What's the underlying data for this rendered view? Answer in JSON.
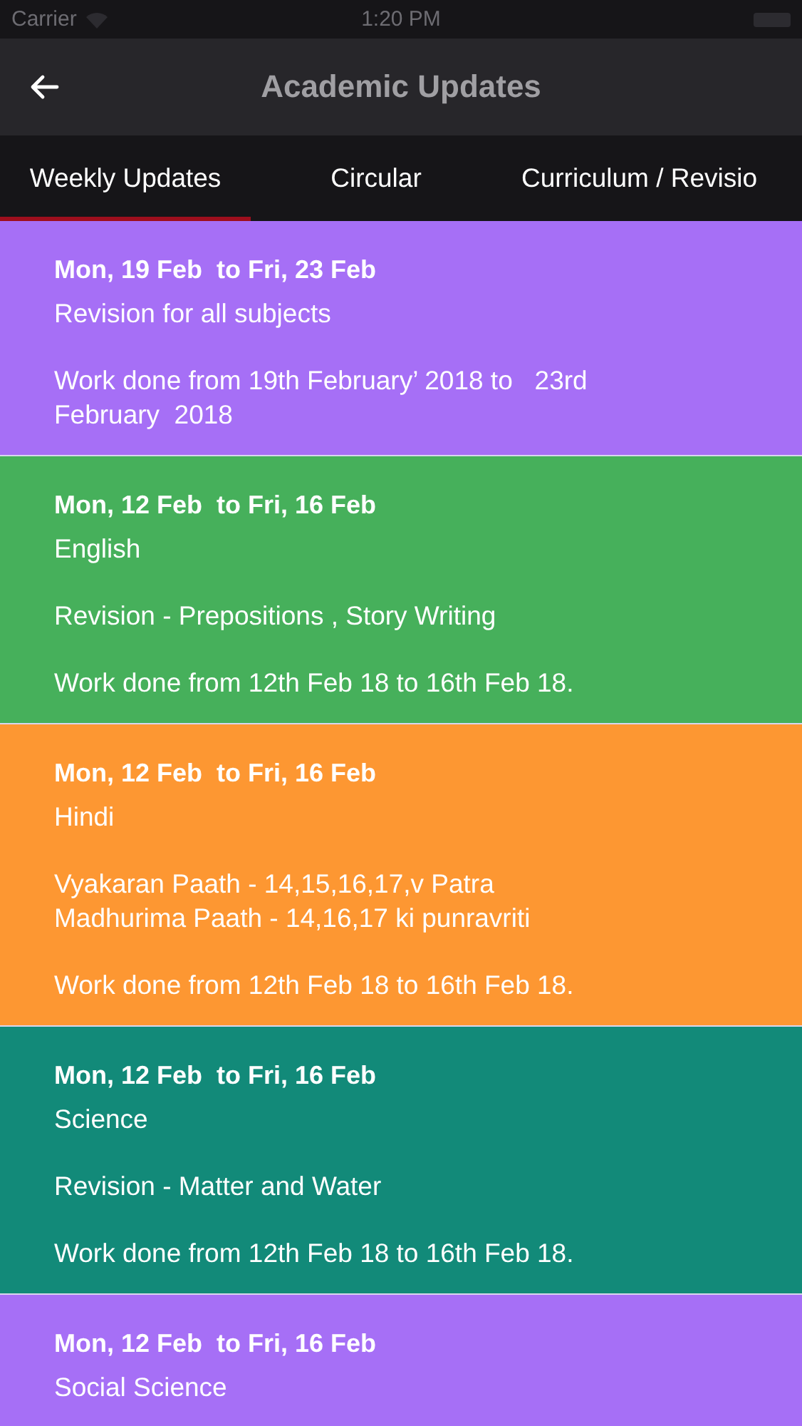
{
  "status_bar": {
    "carrier": "Carrier",
    "time": "1:20 PM"
  },
  "nav": {
    "title": "Academic Updates"
  },
  "tabs": [
    {
      "label": "Weekly Updates",
      "selected": true
    },
    {
      "label": "Circular",
      "selected": false
    },
    {
      "label": "Curriculum / Revisio",
      "selected": false
    }
  ],
  "updates": [
    {
      "color": "#a66ff6",
      "dates": "Mon, 19 Feb  to Fri, 23 Feb",
      "subject": "Revision for all subjects",
      "paragraphs": [
        [
          "Work done from 19th February’ 2018 to   23rd",
          "February  2018"
        ]
      ]
    },
    {
      "color": "#46b05b",
      "dates": "Mon, 12 Feb  to Fri, 16 Feb",
      "subject": "English",
      "paragraphs": [
        [
          "Revision - Prepositions , Story Writing"
        ],
        [
          "Work done from 12th Feb 18 to 16th Feb 18."
        ]
      ]
    },
    {
      "color": "#fd9732",
      "dates": "Mon, 12 Feb  to Fri, 16 Feb",
      "subject": "Hindi",
      "paragraphs": [
        [
          "Vyakaran Paath - 14,15,16,17,v Patra",
          "Madhurima Paath - 14,16,17 ki punravriti"
        ],
        [
          "Work done from 12th Feb 18 to 16th Feb 18."
        ]
      ]
    },
    {
      "color": "#128a79",
      "dates": "Mon, 12 Feb  to Fri, 16 Feb",
      "subject": "Science",
      "paragraphs": [
        [
          "Revision - Matter and Water"
        ],
        [
          "Work done from 12th Feb 18 to 16th Feb 18."
        ]
      ]
    },
    {
      "color": "#a66ff6",
      "dates": "Mon, 12 Feb  to Fri, 16 Feb",
      "subject": "Social Science"
    }
  ]
}
